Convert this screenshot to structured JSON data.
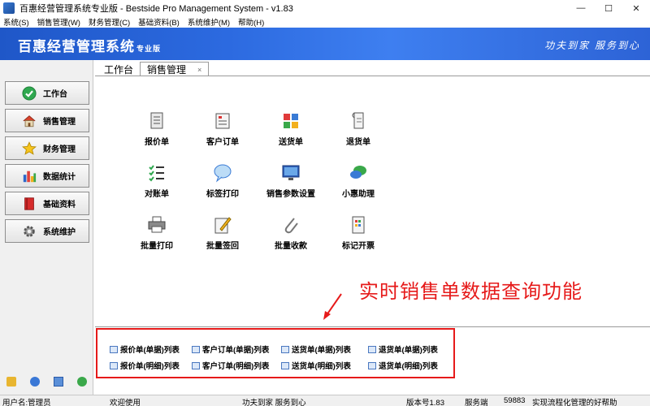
{
  "window": {
    "title": "百惠经营管理系统专业版 - Bestside Pro Management System - v1.83",
    "minimize": "—",
    "maximize": "☐",
    "close": "✕"
  },
  "menu": [
    "系统(S)",
    "销售管理(W)",
    "财务管理(C)",
    "基础资料(B)",
    "系统维护(M)",
    "帮助(H)"
  ],
  "banner": {
    "logo": "百惠经营管理系统",
    "logo_suffix": "专业版",
    "slogan": "功夫到家  服务到心"
  },
  "sidebar": {
    "items": [
      {
        "label": "工作台",
        "icon": "check-icon"
      },
      {
        "label": "销售管理",
        "icon": "house-icon"
      },
      {
        "label": "财务管理",
        "icon": "star-icon"
      },
      {
        "label": "数据统计",
        "icon": "bar-chart-icon"
      },
      {
        "label": "基础资料",
        "icon": "book-icon"
      },
      {
        "label": "系统维护",
        "icon": "gear-icon"
      }
    ]
  },
  "tabs": {
    "workbench": "工作台",
    "sales": "销售管理",
    "close": "×"
  },
  "functions": [
    {
      "label": "报价单",
      "icon": "document-icon"
    },
    {
      "label": "客户订单",
      "icon": "order-icon"
    },
    {
      "label": "送货单",
      "icon": "delivery-icon"
    },
    {
      "label": "退货单",
      "icon": "return-icon"
    },
    {
      "label": "对账单",
      "icon": "checklist-icon"
    },
    {
      "label": "标签打印",
      "icon": "speech-bubble-icon"
    },
    {
      "label": "销售参数设置",
      "icon": "monitor-icon"
    },
    {
      "label": "小惠助理",
      "icon": "assistant-icon"
    },
    {
      "label": "批量打印",
      "icon": "printer-icon"
    },
    {
      "label": "批量签回",
      "icon": "sign-icon"
    },
    {
      "label": "批量收款",
      "icon": "paperclip-icon"
    },
    {
      "label": "标记开票",
      "icon": "invoice-icon"
    }
  ],
  "annotation": "实时销售单数据查询功能",
  "lists": [
    "报价单(单据)列表",
    "客户订单(单据)列表",
    "送货单(单据)列表",
    "退货单(单据)列表",
    "报价单(明细)列表",
    "客户订单(明细)列表",
    "送货单(明细)列表",
    "退货单(明细)列表"
  ],
  "status": {
    "user": "用户名:管理员",
    "welcome": "欢迎使用",
    "motto": "功夫到家 服务到心",
    "version": "版本号1.83",
    "service_label": "服务端",
    "service_value": "59883",
    "tagline": "实现流程化管理的好帮助"
  },
  "colors": {
    "banner": "#2c6ae0",
    "annotation": "#e61a1a"
  }
}
